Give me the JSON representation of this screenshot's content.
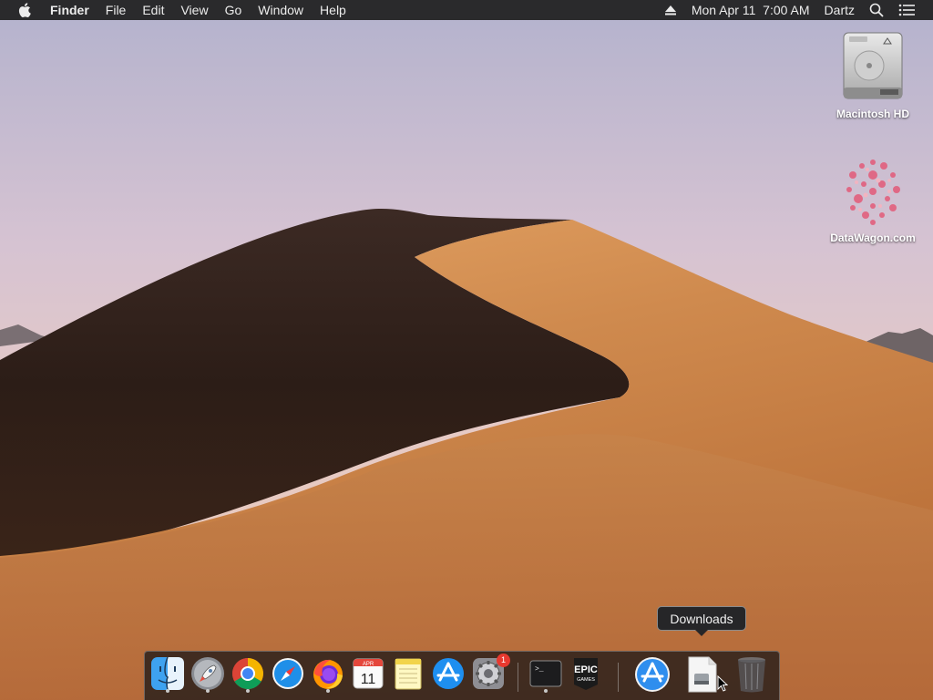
{
  "menubar": {
    "apple_icon": "apple-logo-icon",
    "app_name": "Finder",
    "menus": [
      "File",
      "Edit",
      "View",
      "Go",
      "Window",
      "Help"
    ],
    "clock": "Mon Apr 11  7:00 AM",
    "user": "Dartz"
  },
  "desktop": {
    "icons": [
      {
        "label": "Macintosh HD",
        "icon": "hard-drive-icon"
      },
      {
        "label": "DataWagon.com",
        "icon": "datawagon-image-icon"
      }
    ]
  },
  "dock": {
    "tooltip": "Downloads",
    "items": [
      {
        "name": "Finder",
        "icon": "finder-icon",
        "running": true
      },
      {
        "name": "Launchpad",
        "icon": "launchpad-icon",
        "running": true
      },
      {
        "name": "Google Chrome",
        "icon": "chrome-icon",
        "running": true
      },
      {
        "name": "Safari",
        "icon": "safari-icon",
        "running": false
      },
      {
        "name": "Firefox",
        "icon": "firefox-icon",
        "running": true
      },
      {
        "name": "Calendar",
        "icon": "calendar-icon",
        "running": false,
        "calendar_month": "APR",
        "calendar_day": "11"
      },
      {
        "name": "Notes",
        "icon": "notes-icon",
        "running": false
      },
      {
        "name": "App Store",
        "icon": "app-store-icon",
        "running": false
      },
      {
        "name": "System Preferences",
        "icon": "system-preferences-icon",
        "running": false,
        "badge": "1"
      },
      {
        "name": "Terminal",
        "icon": "terminal-icon",
        "running": true,
        "prompt": ">_"
      },
      {
        "name": "Epic Games Launcher",
        "icon": "epic-games-icon",
        "running": false,
        "text_top": "EPIC",
        "text_bottom": "GAMES"
      },
      {
        "name": "Applications",
        "icon": "applications-folder-icon",
        "running": false
      },
      {
        "name": "Downloads",
        "icon": "downloads-stack-icon",
        "running": false
      },
      {
        "name": "Trash",
        "icon": "trash-icon",
        "running": false
      }
    ]
  },
  "colors": {
    "menubar_bg": "#2a2a2c",
    "badge_red": "#e8392f",
    "dune_shadow": "#2a1a14",
    "dune_light": "#d08a4c"
  }
}
